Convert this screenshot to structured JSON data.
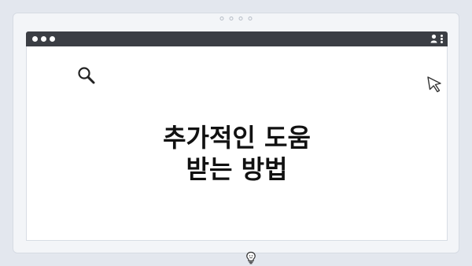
{
  "window": {
    "title_bar_color": "#3b3e44",
    "icons": [
      "traffic-lights",
      "user-icon",
      "kebab-menu-icon"
    ]
  },
  "page_indicator": {
    "dots": 4
  },
  "main": {
    "heading_line1": "추가적인 도움",
    "heading_line2": "받는 방법",
    "icons": [
      "search-icon",
      "cursor-icon",
      "lightbulb-icon"
    ]
  }
}
